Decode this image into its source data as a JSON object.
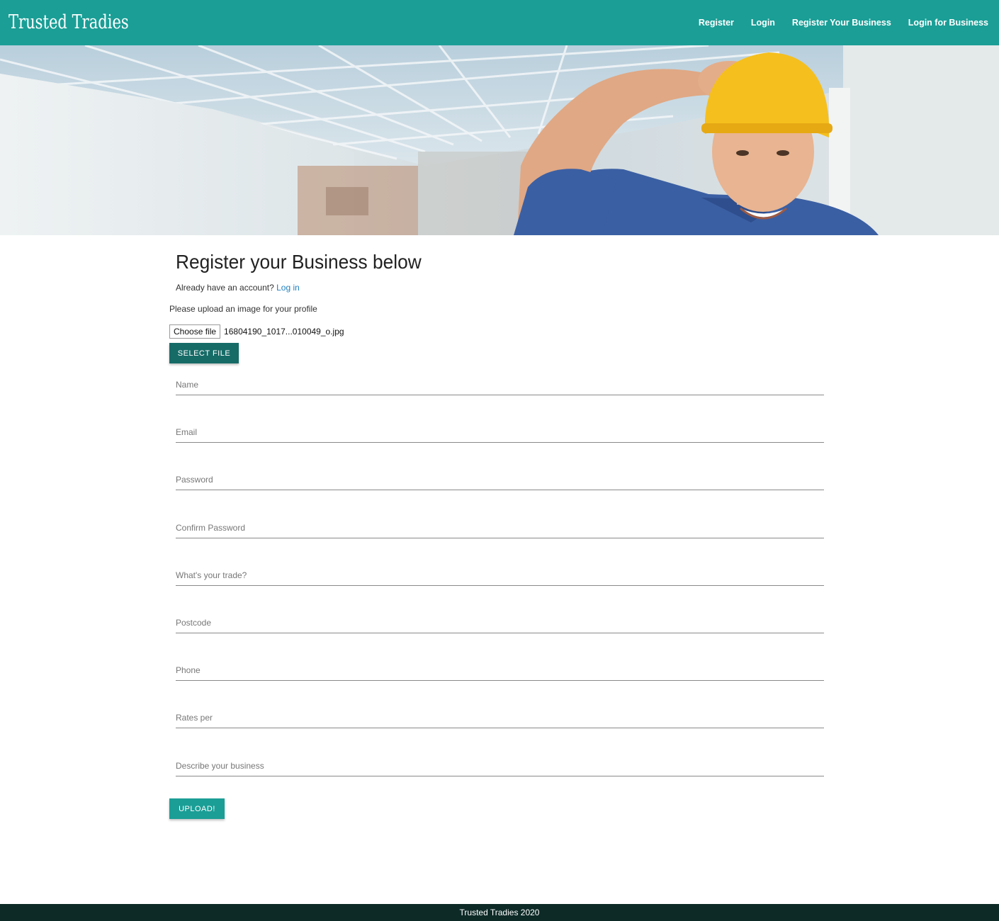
{
  "header": {
    "brand": "Trusted Tradies",
    "nav": [
      "Register",
      "Login",
      "Register Your Business",
      "Login for Business"
    ]
  },
  "main": {
    "title": "Register your Business below",
    "account_prompt": "Already have an account?",
    "login_link": "Log in",
    "upload_prompt": "Please upload an image for your profile",
    "choose_file_label": "Choose file",
    "file_name": "16804190_1017...010049_o.jpg",
    "select_file_label": "SELECT FILE",
    "fields": [
      "Name",
      "Email",
      "Password",
      "Confirm Password",
      "What's your trade?",
      "Postcode",
      "Phone",
      "Rates per",
      "Describe your business"
    ],
    "upload_label": "UPLOAD!"
  },
  "footer": {
    "text": "Trusted Tradies 2020"
  },
  "colors": {
    "primary": "#1a9e96",
    "select_button": "#166b67",
    "footer": "#0d2a27",
    "link": "#1f7fbf"
  },
  "icons": {
    "hero": "hero-tradesman-image"
  }
}
